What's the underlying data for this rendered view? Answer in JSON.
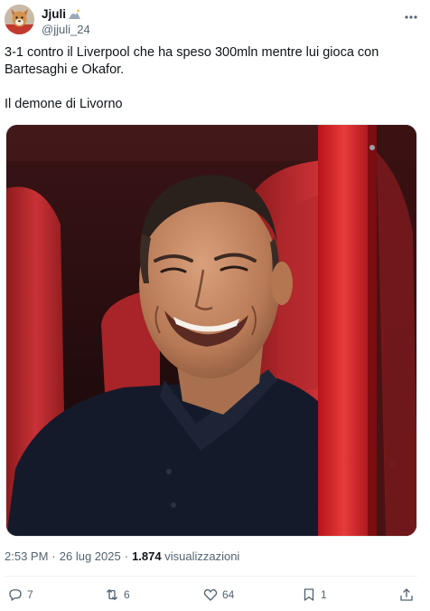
{
  "author": {
    "display_name": "Jjuli",
    "handle": "@jjuli_24",
    "avatar_icon": "avatar-dog-icon",
    "name_emoji_icon": "mountain-emoji-icon"
  },
  "tweet": {
    "line1": "3-1 contro il Liverpool che ha speso 300mln mentre lui gioca con",
    "line2": "Bartesaghi e Okafor.",
    "line3": "Il demone di Livorno"
  },
  "media": {
    "kind": "photo",
    "subject": "smiling-coach-photo"
  },
  "meta": {
    "time": "2:53 PM",
    "separator": "·",
    "date": "26 lug 2025",
    "views_count": "1.874",
    "views_label": "visualizzazioni"
  },
  "actions": {
    "replies": "7",
    "reposts": "6",
    "likes": "64",
    "bookmarks": "1"
  },
  "colors": {
    "text": "#0f1419",
    "secondary": "#536471",
    "divider": "#eff3f4",
    "seat_red": "#c0282b"
  }
}
